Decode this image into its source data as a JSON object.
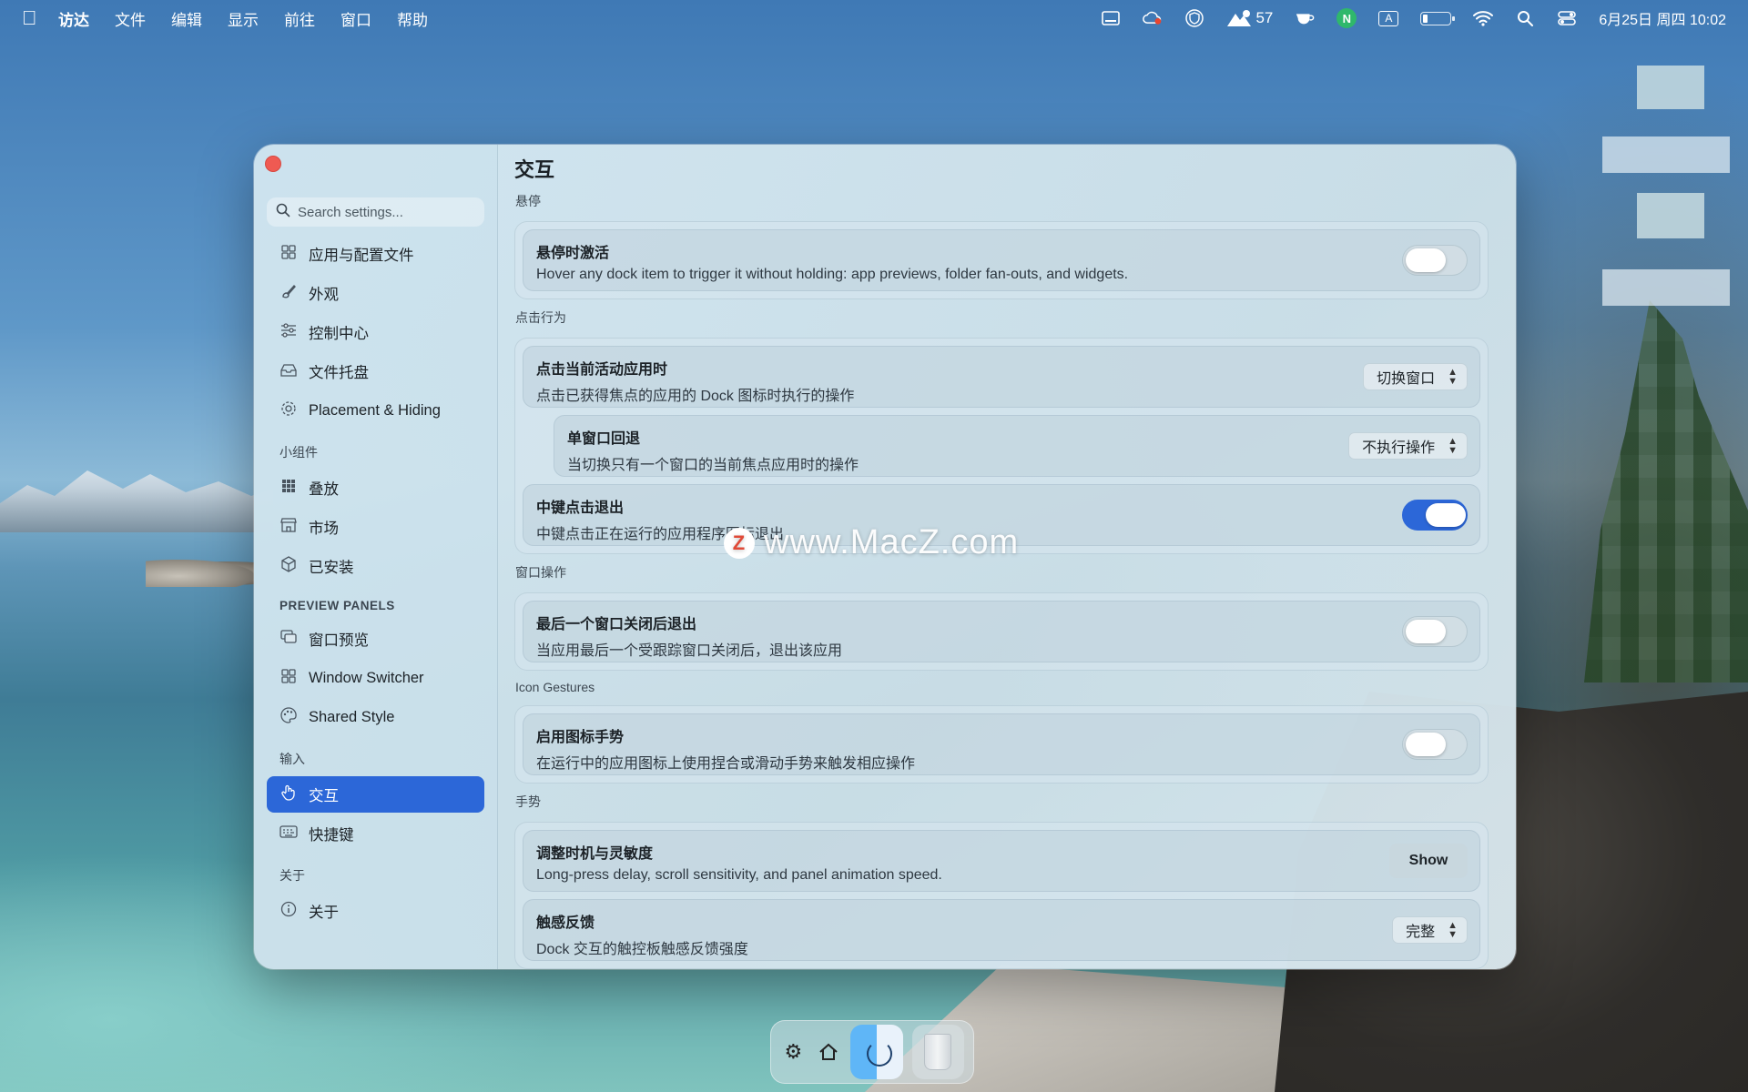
{
  "menubar": {
    "app_name": "访达",
    "items": [
      "文件",
      "编辑",
      "显示",
      "前往",
      "窗口",
      "帮助"
    ],
    "weather_value": "57",
    "input_method": "A",
    "clock": "6月25日 周四  10:02"
  },
  "window": {
    "search_placeholder": "Search settings...",
    "sidebar": {
      "items_top": [
        "应用与配置文件",
        "外观",
        "控制中心",
        "文件托盘",
        "Placement & Hiding"
      ],
      "section_widgets": "小组件",
      "items_widgets": [
        "叠放",
        "市场",
        "已安装"
      ],
      "section_preview": "PREVIEW PANELS",
      "items_preview": [
        "窗口预览",
        "Window Switcher",
        "Shared Style"
      ],
      "section_input": "输入",
      "items_input": [
        "交互",
        "快捷键"
      ],
      "section_about": "关于",
      "items_about": [
        "关于"
      ],
      "active_item": "交互"
    },
    "content": {
      "title": "交互",
      "sections": {
        "hover": {
          "label": "悬停",
          "row": {
            "title": "悬停时激活",
            "desc": "Hover any dock item to trigger it without holding: app previews, folder fan-outs, and widgets.",
            "enabled": false
          }
        },
        "click": {
          "label": "点击行为",
          "row1": {
            "title": "点击当前活动应用时",
            "desc": "点击已获得焦点的应用的 Dock 图标时执行的操作",
            "value": "切换窗口"
          },
          "row2": {
            "title": "单窗口回退",
            "desc": "当切换只有一个窗口的当前焦点应用时的操作",
            "value": "不执行操作"
          },
          "row3": {
            "title": "中键点击退出",
            "desc": "中键点击正在运行的应用程序图标退出",
            "enabled": true
          }
        },
        "window_ops": {
          "label": "窗口操作",
          "row": {
            "title": "最后一个窗口关闭后退出",
            "desc": "当应用最后一个受跟踪窗口关闭后，退出该应用",
            "enabled": false
          }
        },
        "icon_gestures": {
          "label": "Icon Gestures",
          "row": {
            "title": "启用图标手势",
            "desc": "在运行中的应用图标上使用捏合或滑动手势来触发相应操作",
            "enabled": false
          }
        },
        "gestures": {
          "label": "手势",
          "row1": {
            "title": "调整时机与灵敏度",
            "desc": "Long-press delay, scroll sensitivity, and panel animation speed.",
            "button": "Show"
          },
          "row2": {
            "title": "触感反馈",
            "desc": "Dock 交互的触控板触感反馈强度",
            "value": "完整"
          }
        }
      }
    }
  },
  "watermark": {
    "logo": "Z",
    "text": "www.MacZ.com"
  },
  "colors": {
    "accent": "#2c67d8",
    "close": "#ef5a52"
  }
}
